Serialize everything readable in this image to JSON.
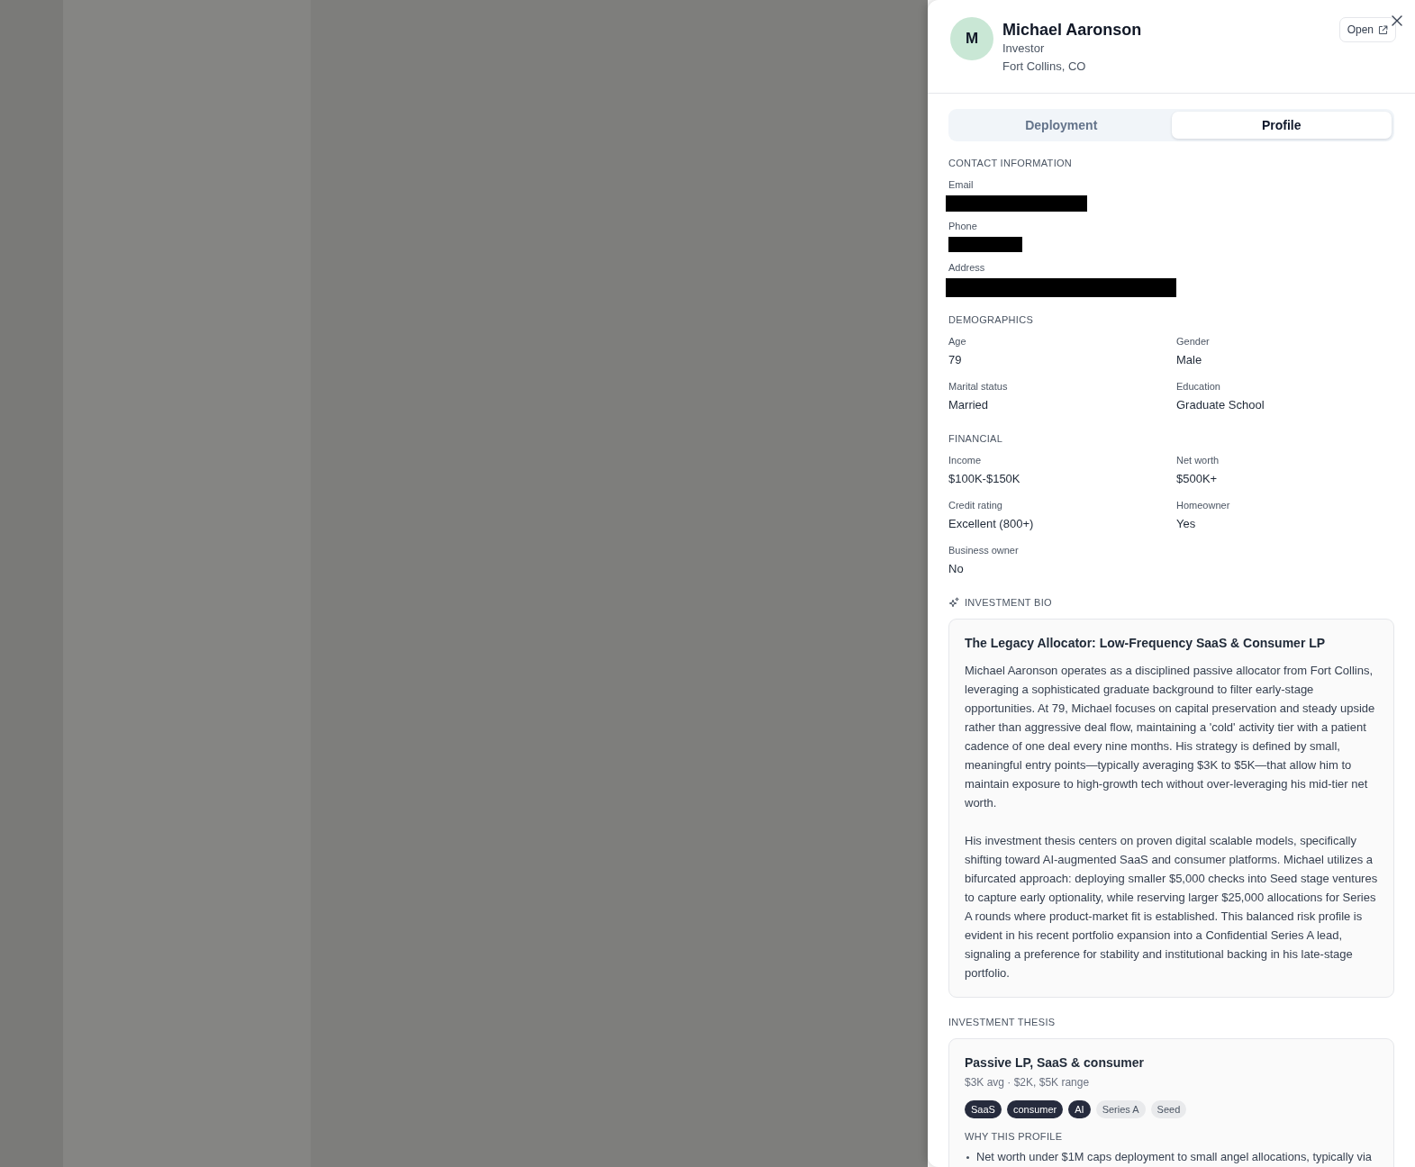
{
  "profile": {
    "initial": "M",
    "name": "Michael Aaronson",
    "role": "Investor",
    "location": "Fort Collins, CO",
    "open_label": "Open"
  },
  "tabs": [
    {
      "label": "Deployment",
      "selected": false
    },
    {
      "label": "Profile",
      "selected": true
    }
  ],
  "contact": {
    "title": "CONTACT INFORMATION",
    "fields": [
      {
        "label": "Email",
        "redacted": true
      },
      {
        "label": "Phone",
        "redacted": true
      },
      {
        "label": "Address",
        "redacted": true
      }
    ]
  },
  "demographics": {
    "title": "DEMOGRAPHICS",
    "fields": [
      {
        "label": "Age",
        "value": "79"
      },
      {
        "label": "Gender",
        "value": "Male"
      },
      {
        "label": "Marital status",
        "value": "Married"
      },
      {
        "label": "Education",
        "value": "Graduate School"
      }
    ]
  },
  "financial": {
    "title": "FINANCIAL",
    "fields": [
      {
        "label": "Income",
        "value": "$100K-$150K"
      },
      {
        "label": "Net worth",
        "value": "$500K+"
      },
      {
        "label": "Credit rating",
        "value": "Excellent (800+)"
      },
      {
        "label": "Homeowner",
        "value": "Yes"
      },
      {
        "label": "Business owner",
        "value": "No"
      }
    ]
  },
  "investment_bio": {
    "title": "INVESTMENT BIO",
    "heading": "The Legacy Allocator: Low-Frequency SaaS & Consumer LP",
    "paragraphs": [
      "Michael Aaronson operates as a disciplined passive allocator from Fort Collins, leveraging a sophisticated graduate background to filter early-stage opportunities. At 79, Michael focuses on capital preservation and steady upside rather than aggressive deal flow, maintaining a 'cold' activity tier with a patient cadence of one deal every nine months. His strategy is defined by small, meaningful entry points—typically averaging $3K to $5K—that allow him to maintain exposure to high-growth tech without over-leveraging his mid-tier net worth.",
      "His investment thesis centers on proven digital scalable models, specifically shifting toward AI-augmented SaaS and consumer platforms. Michael utilizes a bifurcated approach: deploying smaller $5,000 checks into Seed stage ventures to capture early optionality, while reserving larger $25,000 allocations for Series A rounds where product-market fit is established. This balanced risk profile is evident in his recent portfolio expansion into a Confidential Series A lead, signaling a preference for stability and institutional backing in his late-stage portfolio."
    ]
  },
  "investment_thesis": {
    "title": "INVESTMENT THESIS",
    "heading": "Passive LP, SaaS & consumer",
    "summary": "$3K avg · $2K, $5K range",
    "tags": [
      {
        "label": "SaaS",
        "highlighted": true
      },
      {
        "label": "consumer",
        "highlighted": true
      },
      {
        "label": "AI",
        "highlighted": true
      },
      {
        "label": "Series A",
        "highlighted": false
      },
      {
        "label": "Seed",
        "highlighted": false
      }
    ],
    "why_title": "WHY THIS PROFILE",
    "reasons": [
      "Net worth under $1M caps deployment to small angel allocations, typically via"
    ]
  }
}
